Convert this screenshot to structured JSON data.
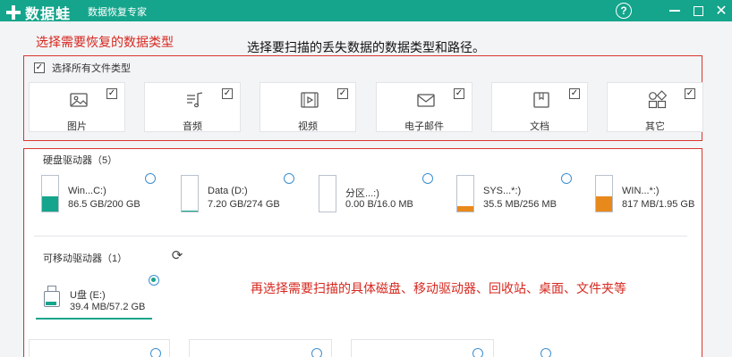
{
  "app": {
    "logo_text": "数据蛙",
    "subtitle": "数据恢复专家",
    "help_icon": "question-icon",
    "help_glyph": "?",
    "close_glyph": "✕",
    "brand_color": "#14a58c"
  },
  "annotations": {
    "top_red": "选择需要恢复的数据类型",
    "top_instruction": "选择要扫描的丢失数据的数据类型和路径。",
    "middle_red": "再选择需要扫描的具体磁盘、移动驱动器、回收站、桌面、文件夹等"
  },
  "file_types": {
    "select_all_label": "选择所有文件类型",
    "select_all_checked": true,
    "check_glyph": "✓",
    "items": [
      {
        "label": "图片",
        "icon": "image-icon",
        "checked": true
      },
      {
        "label": "音频",
        "icon": "audio-icon",
        "checked": true
      },
      {
        "label": "视频",
        "icon": "video-icon",
        "checked": true
      },
      {
        "label": "电子邮件",
        "icon": "email-icon",
        "checked": true
      },
      {
        "label": "文档",
        "icon": "document-icon",
        "checked": true
      },
      {
        "label": "其它",
        "icon": "other-icon",
        "checked": true
      }
    ]
  },
  "hard_drives": {
    "title": "硬盘驱动器（5）",
    "items": [
      {
        "name": "Win...C:)",
        "size": "86.5 GB/200 GB",
        "used_fraction": 0.43,
        "fill_color": "#14a58c",
        "selected": false
      },
      {
        "name": "Data (D:)",
        "size": "7.20 GB/274 GB",
        "used_fraction": 0.03,
        "fill_color": "#14a58c",
        "selected": false
      },
      {
        "name": "分区...:)",
        "size": "0.00 B/16.0 MB",
        "used_fraction": 0.0,
        "fill_color": "#14a58c",
        "selected": false
      },
      {
        "name": "SYS...*:)",
        "size": "35.5 MB/256 MB",
        "used_fraction": 0.14,
        "fill_color": "#e8891c",
        "selected": false
      },
      {
        "name": "WIN...*:)",
        "size": "817 MB/1.95 GB",
        "used_fraction": 0.42,
        "fill_color": "#e8891c",
        "selected": false
      }
    ]
  },
  "removable_drives": {
    "title": "可移动驱动器（1）",
    "refresh_icon": "refresh-icon",
    "refresh_glyph": "⟳",
    "items": [
      {
        "name": "U盘 (E:)",
        "size": "39.4 MB/57.2 GB",
        "selected": true
      }
    ]
  }
}
